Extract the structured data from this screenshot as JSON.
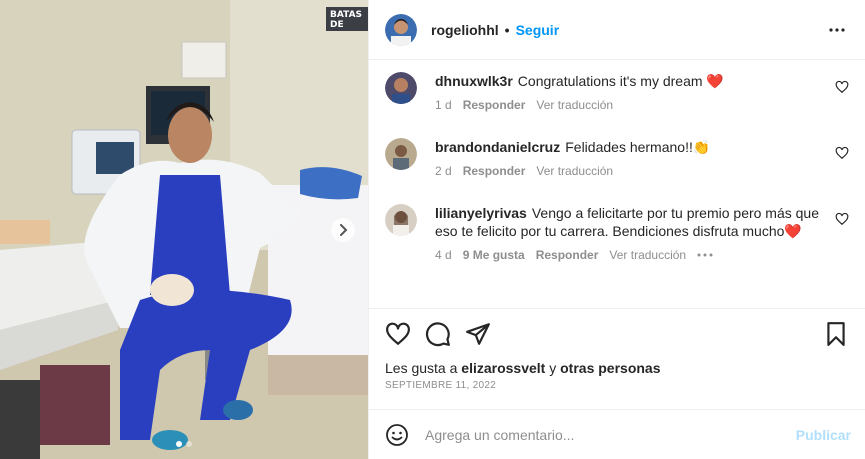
{
  "post": {
    "username": "rogeliohhl",
    "separator": "•",
    "follow_label": "Seguir"
  },
  "photo": {
    "sign_text": "BATAS DE",
    "carousel_dots": 2,
    "active_dot": 0
  },
  "comments": [
    {
      "username": "dhnuxwlk3r",
      "text": "Congratulations it's my dream ❤️",
      "time": "1 d",
      "likes": "",
      "reply_label": "Responder",
      "translate_label": "Ver traducción"
    },
    {
      "username": "brandondanielcruz",
      "text": "Felidades hermano!!👏",
      "time": "2 d",
      "likes": "",
      "reply_label": "Responder",
      "translate_label": "Ver traducción"
    },
    {
      "username": "lilianyelyrivas",
      "text": "Vengo a felicitarte por tu premio pero más que eso te felicito por tu carrera. Bendiciones disfruta mucho❤️",
      "time": "4 d",
      "likes": "9 Me gusta",
      "reply_label": "Responder",
      "translate_label": "Ver traducción"
    }
  ],
  "likes_line": {
    "prefix": "Les gusta a",
    "user": "elizarossvelt",
    "conj": "y",
    "others": "otras personas"
  },
  "date": "SEPTIEMBRE 11, 2022",
  "add_comment": {
    "placeholder": "Agrega un comentario...",
    "publish_label": "Publicar"
  },
  "colors": {
    "link_blue": "#0095f6",
    "disabled_blue": "#b2dffc",
    "muted": "#8e8e8e",
    "scrubs": "#2a3fbf"
  }
}
